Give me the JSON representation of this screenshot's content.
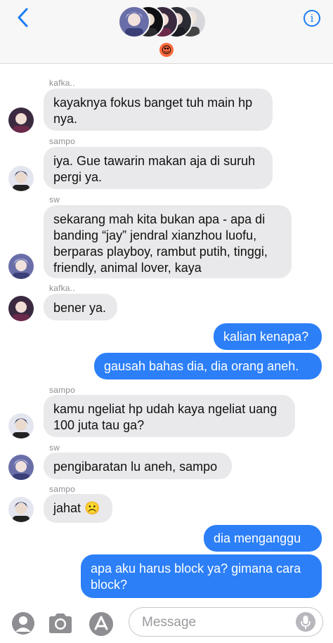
{
  "header": {
    "group_emoji": "😍",
    "accent": "#1a7cf5"
  },
  "messages": [
    {
      "sender": "kafka..",
      "text": "kayaknya fokus banget tuh main hp nya."
    },
    {
      "sender": "sampo",
      "text": "iya. Gue tawarin makan aja di suruh pergi ya."
    },
    {
      "sender": "sw",
      "text": "sekarang mah kita bukan apa - apa di banding “jay” jendral xianzhou luofu, berparas playboy, rambut putih, tinggi, friendly, animal lover, kaya"
    },
    {
      "sender": "kafka..",
      "text": "bener ya."
    },
    {
      "text": "kalian kenapa?"
    },
    {
      "text": "gausah bahas dia, dia orang aneh."
    },
    {
      "sender": "sampo",
      "text": "kamu ngeliat hp udah kaya ngeliat uang 100 juta tau ga?"
    },
    {
      "sender": "sw",
      "text": "pengibaratan lu aneh, sampo"
    },
    {
      "sender": "sampo",
      "text": "jahat ☹️"
    },
    {
      "text": "dia menganggu"
    },
    {
      "text": "apa aku harus block ya? gimana cara block?"
    }
  ],
  "composer": {
    "placeholder": "Message"
  },
  "colors": {
    "outgoing_bubble": "#2c7ff7",
    "incoming_bubble": "#e9e9eb",
    "header_bg": "#f7f7f7"
  }
}
